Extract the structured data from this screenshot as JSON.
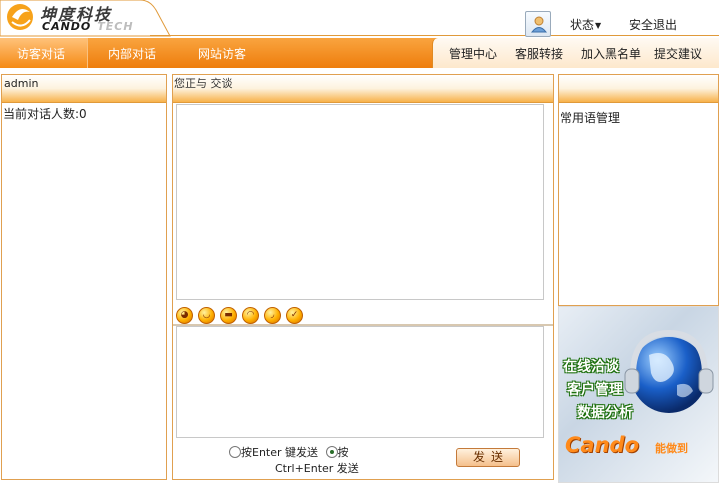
{
  "header": {
    "logo_cn": "坤度科技",
    "logo_en_main": "CANDO",
    "logo_en_sub": "TECH",
    "status_label": "状态",
    "logout_label": "安全退出"
  },
  "nav": {
    "tabs": [
      {
        "label": "访客对话",
        "active": true
      },
      {
        "label": "内部对话",
        "active": false
      },
      {
        "label": "网站访客",
        "active": false
      }
    ],
    "right_items": [
      "管理中心",
      "客服转接",
      "加入黑名单",
      "提交建议"
    ]
  },
  "left_panel": {
    "header": "admin",
    "count_text": "当前对话人数:0"
  },
  "center_panel": {
    "title": "您正与 交谈",
    "emoji_icons": [
      "smile-icon",
      "grin-icon",
      "cool-icon",
      "laugh-icon",
      "cry-icon",
      "wink-icon"
    ],
    "send_option_1": "按Enter 键发送",
    "send_option_2_a": "按",
    "send_option_2_b": "Ctrl+Enter 发送",
    "selected_option": 2,
    "send_label": "发送"
  },
  "right_panel": {
    "header": "",
    "content": "常用语管理"
  },
  "ad": {
    "line1": "在线洽谈",
    "line2": "客户管理",
    "line3": "数据分析",
    "brand": "Cando",
    "brand_cn": "能做到"
  },
  "colors": {
    "accent_orange": "#f58a14",
    "panel_border": "#e0a050"
  }
}
